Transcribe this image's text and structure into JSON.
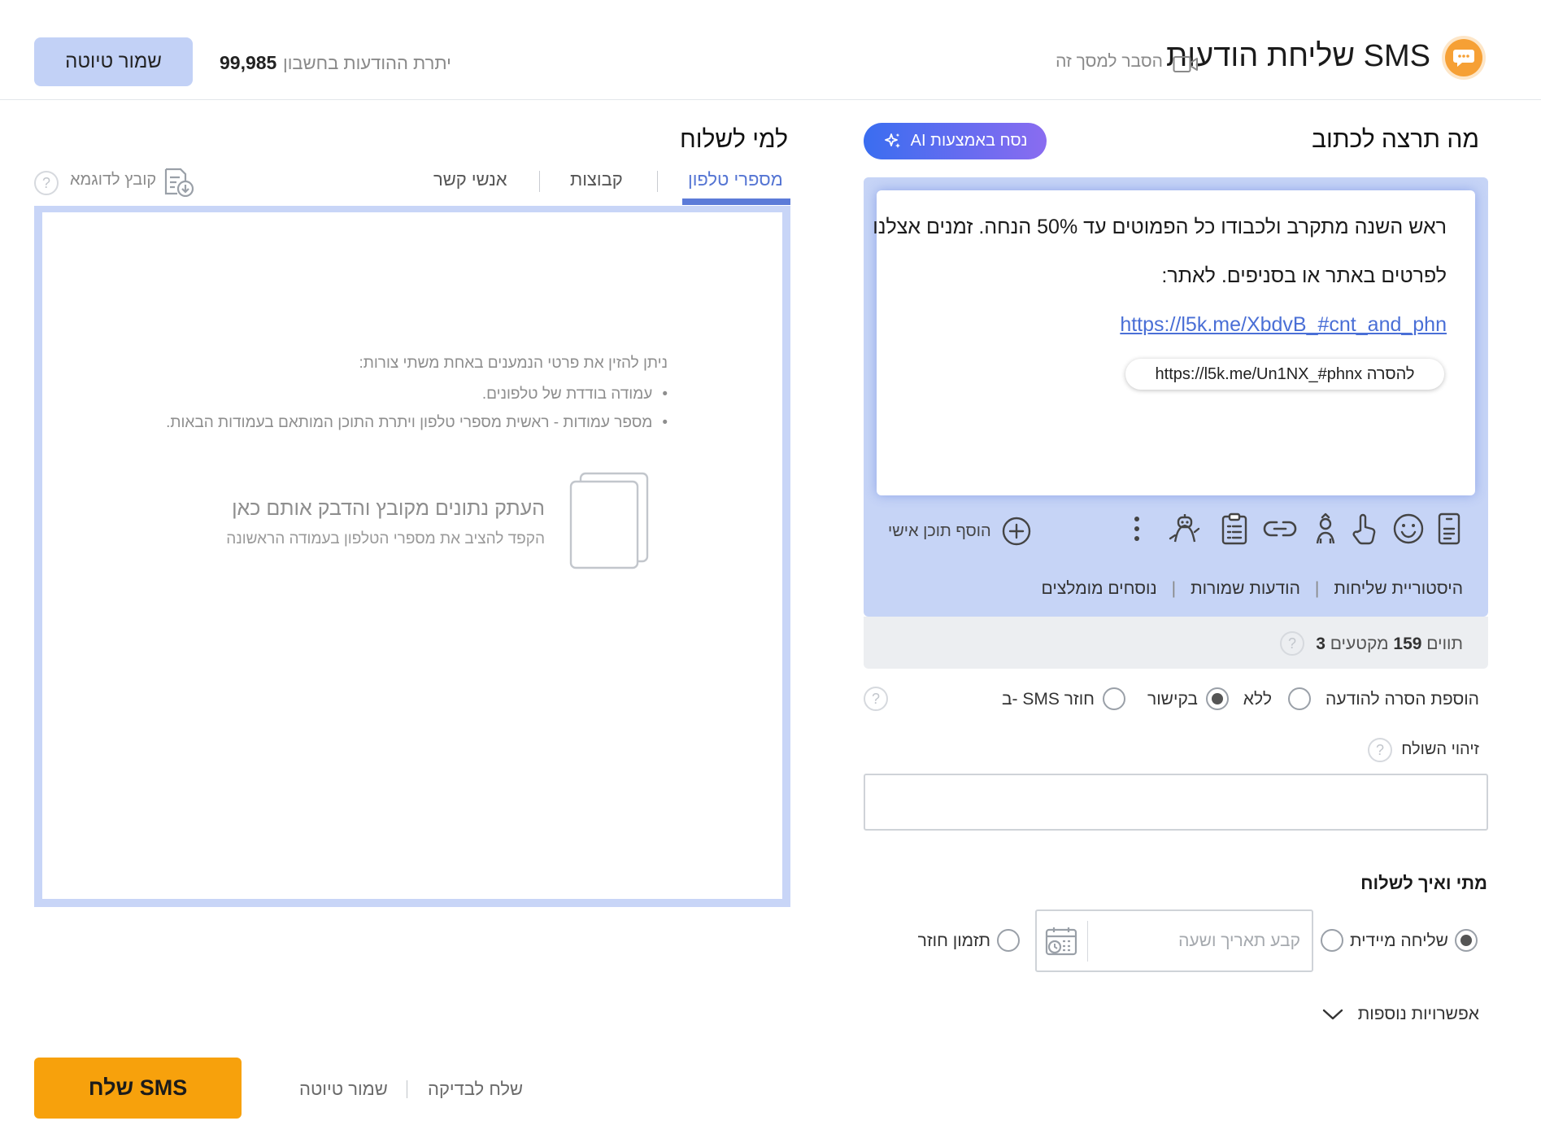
{
  "header": {
    "title": "שליחת הודעות SMS",
    "explain_link": "הסבר למסך זה",
    "balance_label": "יתרת ההודעות בחשבון",
    "balance_value": "99,985",
    "save_draft": "שמור טיוטה"
  },
  "compose": {
    "title": "מה תרצה לכתוב",
    "ai_button": "נסח באמצעות AI",
    "message_line1": "ראש השנה מתקרב ולכבודו כל הפמוטים עד 50% הנחה. זמנים אצלנו",
    "message_line2": "לפרטים באתר או בסניפים. לאתר:",
    "message_link": "https://l5k.me/XbdvB_#cnt_and_phn",
    "unsubscribe_chip": "להסרה https://l5k.me/Un1NX_#phnx",
    "add_personal": "הוסף תוכן אישי",
    "links": [
      "היסטוריית שליחות",
      "הודעות שמורות",
      "נוסחים מומלצים"
    ],
    "counter_chars_label": "תווים",
    "counter_chars": "159",
    "counter_segments_label": "מקטעים",
    "counter_segments": "3"
  },
  "unsubscribe": {
    "label": "הוספת הסרה להודעה",
    "options": [
      "ללא",
      "בקישור",
      "ב- SMS חוזר"
    ],
    "selected": "בקישור"
  },
  "sender": {
    "label": "זיהוי השולח",
    "value": ""
  },
  "schedule": {
    "title": "מתי ואיך לשלוח",
    "immediate": "שליחה מיידית",
    "date_placeholder": "קבע תאריך ושעה",
    "recurring": "תזמון חוזר",
    "more_options": "אפשרויות נוספות"
  },
  "recipients": {
    "title": "למי לשלוח",
    "tabs": [
      "מספרי טלפון",
      "קבוצות",
      "אנשי קשר"
    ],
    "active_tab": "מספרי טלפון",
    "sample_file": "קובץ לדוגמא",
    "instructions_title": "ניתן להזין את פרטי הנמענים באחת משתי צורות:",
    "instruction_1": "עמודה בודדת של טלפונים.",
    "instruction_2": "מספר עמודות - ראשית מספרי טלפון ויתרת התוכן המותאם בעמודות הבאות.",
    "paste_title": "העתק נתונים מקובץ והדבק אותם כאן",
    "paste_subtitle": "הקפד להציב את מספרי הטלפון בעמודה הראשונה"
  },
  "actions": {
    "send": "שלח SMS",
    "save_draft": "שמור טיוטה",
    "send_test": "שלח לבדיקה"
  },
  "colors": {
    "accent": "#f7a10c",
    "primary": "#5575d3",
    "panel": "#c6d4f6"
  }
}
